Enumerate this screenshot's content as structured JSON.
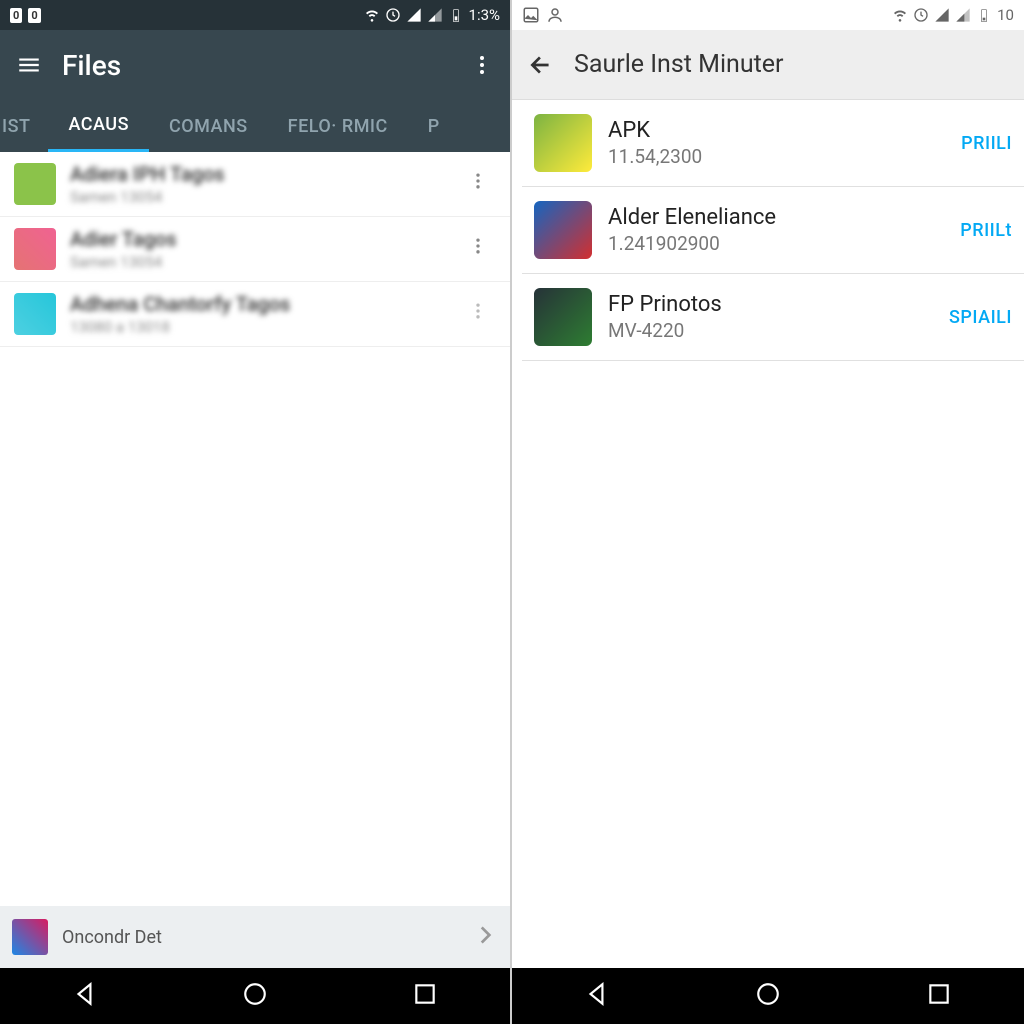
{
  "left": {
    "status": {
      "battery": "1:3%"
    },
    "appbar": {
      "title": "Files"
    },
    "tabs": [
      "IST",
      "ACAUS",
      "COMANS",
      "FELO· RMIC",
      "P"
    ],
    "active_tab": 1,
    "files": [
      {
        "title": "Adiera IPH Tagos",
        "sub": "Samen 13054"
      },
      {
        "title": "Adier Tagos",
        "sub": "Samen 13054"
      },
      {
        "title": "Adhena Chantorfy Tagos",
        "sub": "13080 a 13018"
      }
    ],
    "bottom": {
      "label": "Oncondr Det"
    }
  },
  "right": {
    "status": {
      "battery": "10"
    },
    "appbar": {
      "title": "Saurle Inst Minuter"
    },
    "items": [
      {
        "title": "APK",
        "sub": "11.54,2300",
        "action": "PRIILI"
      },
      {
        "title": "Alder Eleneliance",
        "sub": "1.241902900",
        "action": "PRIILt"
      },
      {
        "title": "FP Prinotos",
        "sub": "MV-4220",
        "action": "SPIAILI"
      }
    ]
  }
}
